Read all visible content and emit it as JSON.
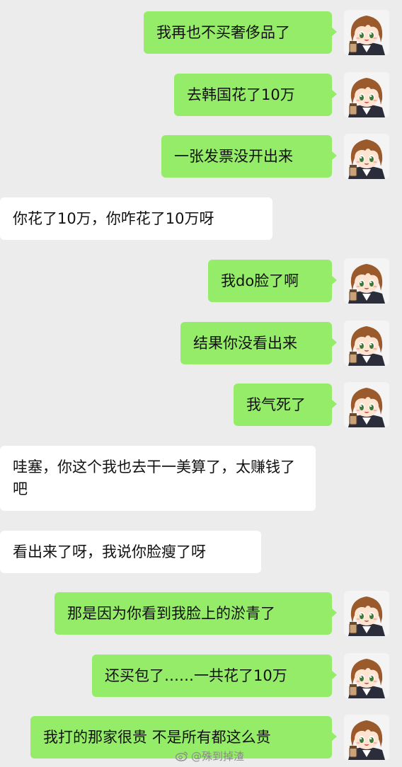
{
  "messages": [
    {
      "side": "sent",
      "text": "我再也不买奢侈品了"
    },
    {
      "side": "sent",
      "text": "去韩国花了10万"
    },
    {
      "side": "sent",
      "text": "一张发票没开出来"
    },
    {
      "side": "received",
      "text": "你花了10万，你咋花了10万呀"
    },
    {
      "side": "sent",
      "text": "我do脸了啊"
    },
    {
      "side": "sent",
      "text": "结果你没看出来"
    },
    {
      "side": "sent",
      "text": "我气死了"
    },
    {
      "side": "received",
      "text": "哇塞，你这个我也去干一美算了，太赚钱了吧"
    },
    {
      "side": "received",
      "text": "看出来了呀，我说你脸瘦了呀"
    },
    {
      "side": "sent",
      "text": "那是因为你看到我脸上的淤青了"
    },
    {
      "side": "sent",
      "text": "还买包了……一共花了10万"
    },
    {
      "side": "sent",
      "text": "我打的那家很贵 不是所有都这么贵"
    }
  ],
  "avatar_icon": "anime-girl-avatar-icon",
  "colors": {
    "background": "#ececec",
    "sent_bubble": "#95ec69",
    "received_bubble": "#ffffff"
  },
  "watermark": {
    "icon": "weibo-logo-icon",
    "text": "@殊到掉渣"
  }
}
